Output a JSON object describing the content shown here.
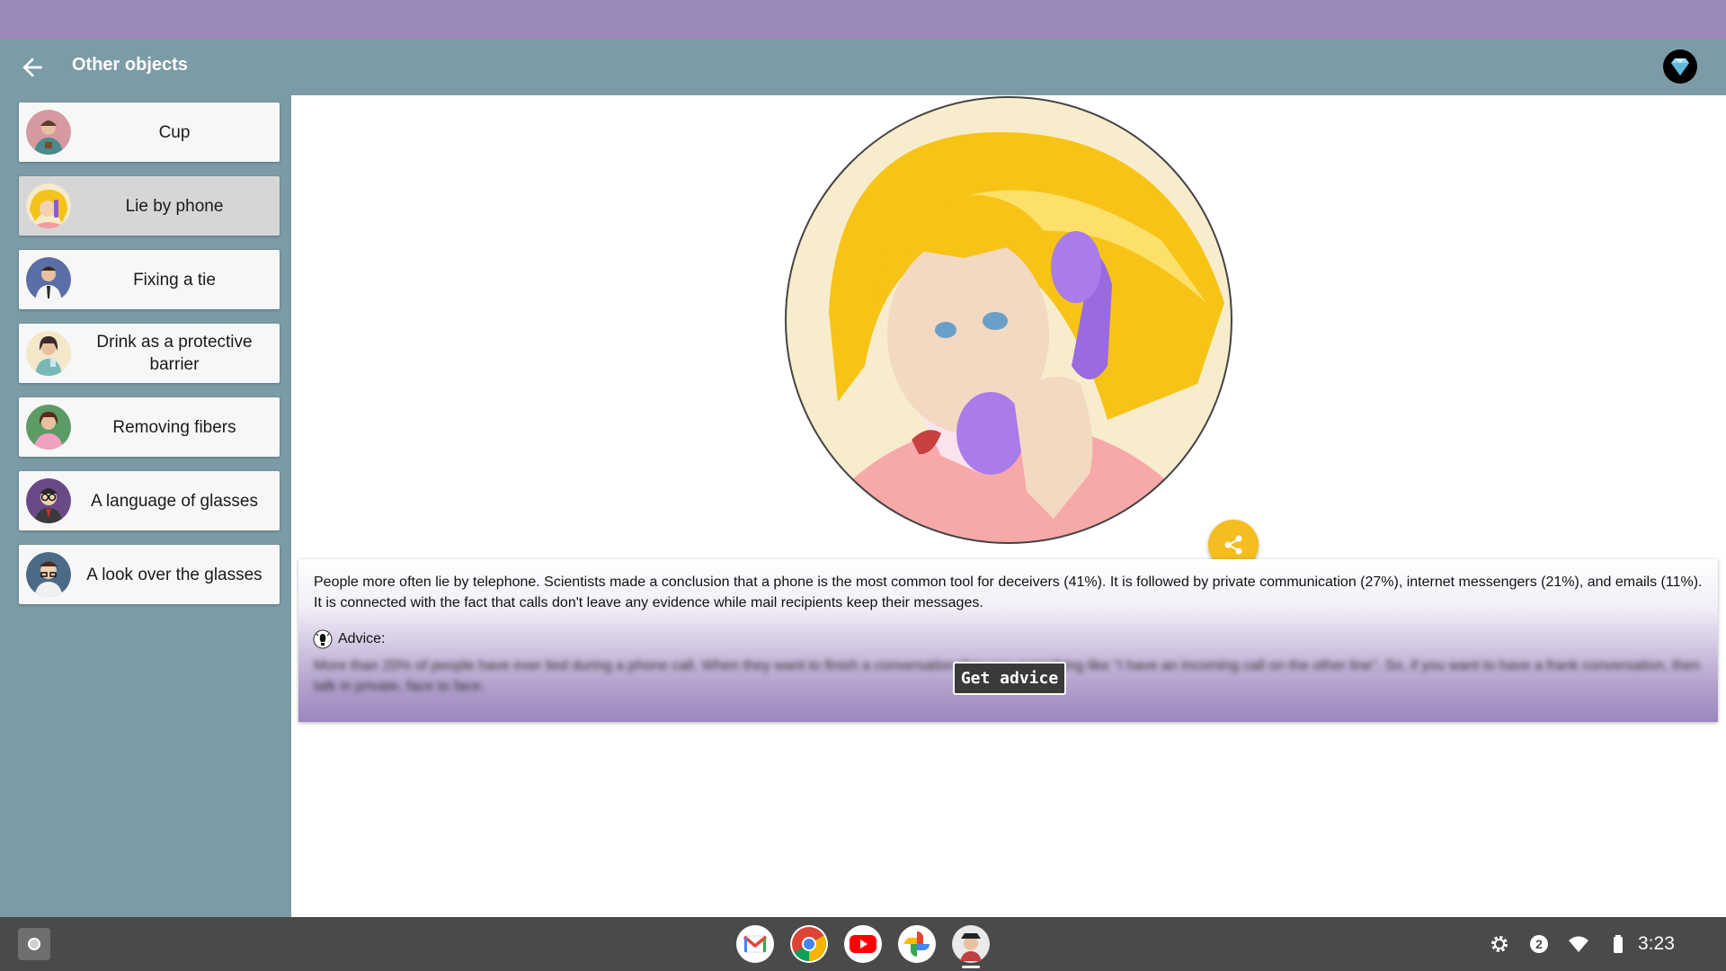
{
  "app_bar": {
    "title": "Other objects",
    "back_icon": "arrow-back-icon",
    "premium_icon": "diamond-icon"
  },
  "sidebar": {
    "items": [
      {
        "label": "Cup",
        "icon": "cup-avatar",
        "selected": false
      },
      {
        "label": "Lie by phone",
        "icon": "phone-avatar",
        "selected": true
      },
      {
        "label": "Fixing a tie",
        "icon": "tie-avatar",
        "selected": false
      },
      {
        "label": "Drink as a protective barrier",
        "icon": "drink-avatar",
        "selected": false
      },
      {
        "label": "Removing fibers",
        "icon": "fibers-avatar",
        "selected": false
      },
      {
        "label": "A language of glasses",
        "icon": "glasses-avatar",
        "selected": false
      },
      {
        "label": "A look over the glasses",
        "icon": "look-over-glasses-avatar",
        "selected": false
      }
    ]
  },
  "article": {
    "text": "People more often lie by telephone. Scientists made a conclusion that a phone is the most common tool for deceivers (41%). It is followed by private communication (27%), internet messengers (21%), and emails (11%). It is connected with the fact that calls don't leave any evidence while mail recipients keep their messages.",
    "advice_label": "Advice:",
    "advice_hidden": "More than 20% of people have ever lied during a phone call. When they want to finish a conversation they say something like \"I have an incoming call on the other line\". So, if you want to have a frank conversation, then talk in private, face to face.",
    "get_advice_button": "Get advice"
  },
  "colors": {
    "status_bar": "#9a88b8",
    "app_bar": "#7b9ca6",
    "share_fab": "#f5bd1f",
    "shelf": "#4a4a4a"
  },
  "shelf": {
    "apps": [
      "gmail-icon",
      "chrome-icon",
      "youtube-icon",
      "photos-icon",
      "body-language-app-icon"
    ],
    "notification_count": "2",
    "time": "3:23"
  }
}
